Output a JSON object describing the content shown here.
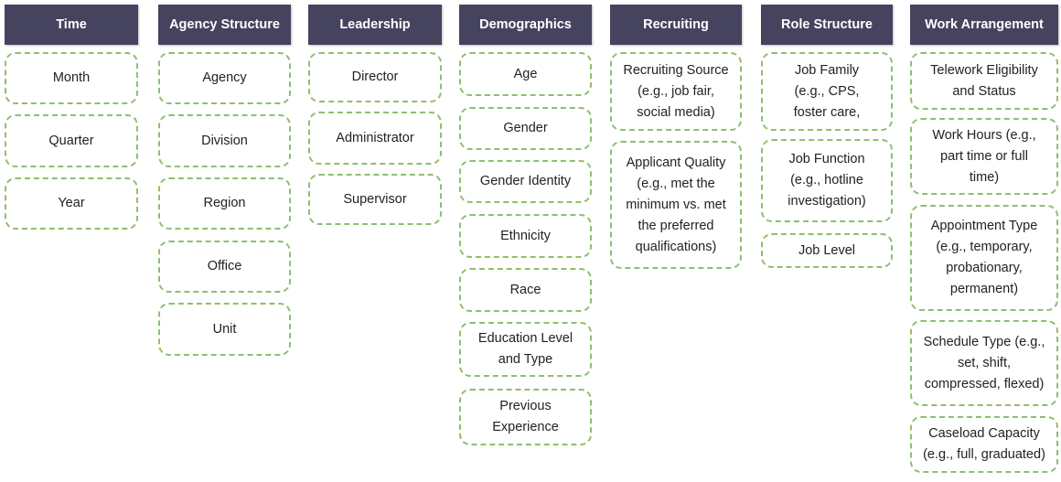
{
  "columns": [
    {
      "title": "Time",
      "items": [
        "Month",
        "Quarter",
        "Year"
      ]
    },
    {
      "title": "Agency Structure",
      "items": [
        "Agency",
        "Division",
        "Region",
        "Office",
        "Unit"
      ]
    },
    {
      "title": "Leadership",
      "items": [
        "Director",
        "Administrator",
        "Supervisor"
      ]
    },
    {
      "title": "Demographics",
      "items": [
        "Age",
        "Gender",
        "Gender Identity",
        "Ethnicity",
        "Race",
        "Education Level\nand Type",
        "Previous\nExperience"
      ]
    },
    {
      "title": "Recruiting",
      "items": [
        "Recruiting Source\n(e.g., job fair,\nsocial media)",
        "Applicant Quality\n(e.g., met the\nminimum vs. met\nthe preferred\nqualifications)"
      ]
    },
    {
      "title": "Role Structure",
      "items": [
        "Job Family\n(e.g., CPS,\nfoster care,",
        "Job Function\n(e.g., hotline\ninvestigation)",
        "Job Level"
      ]
    },
    {
      "title": "Work Arrangement",
      "items": [
        "Telework Eligibility\nand Status",
        "Work Hours (e.g.,\npart time or full\ntime)",
        "Appointment Type\n(e.g., temporary,\nprobationary,\npermanent)",
        "Schedule Type (e.g.,\nset, shift,\ncompressed, flexed)",
        "Caseload Capacity\n(e.g., full, graduated)"
      ]
    }
  ],
  "colors": {
    "header": "#45435e",
    "border": "#8fbf6c"
  }
}
